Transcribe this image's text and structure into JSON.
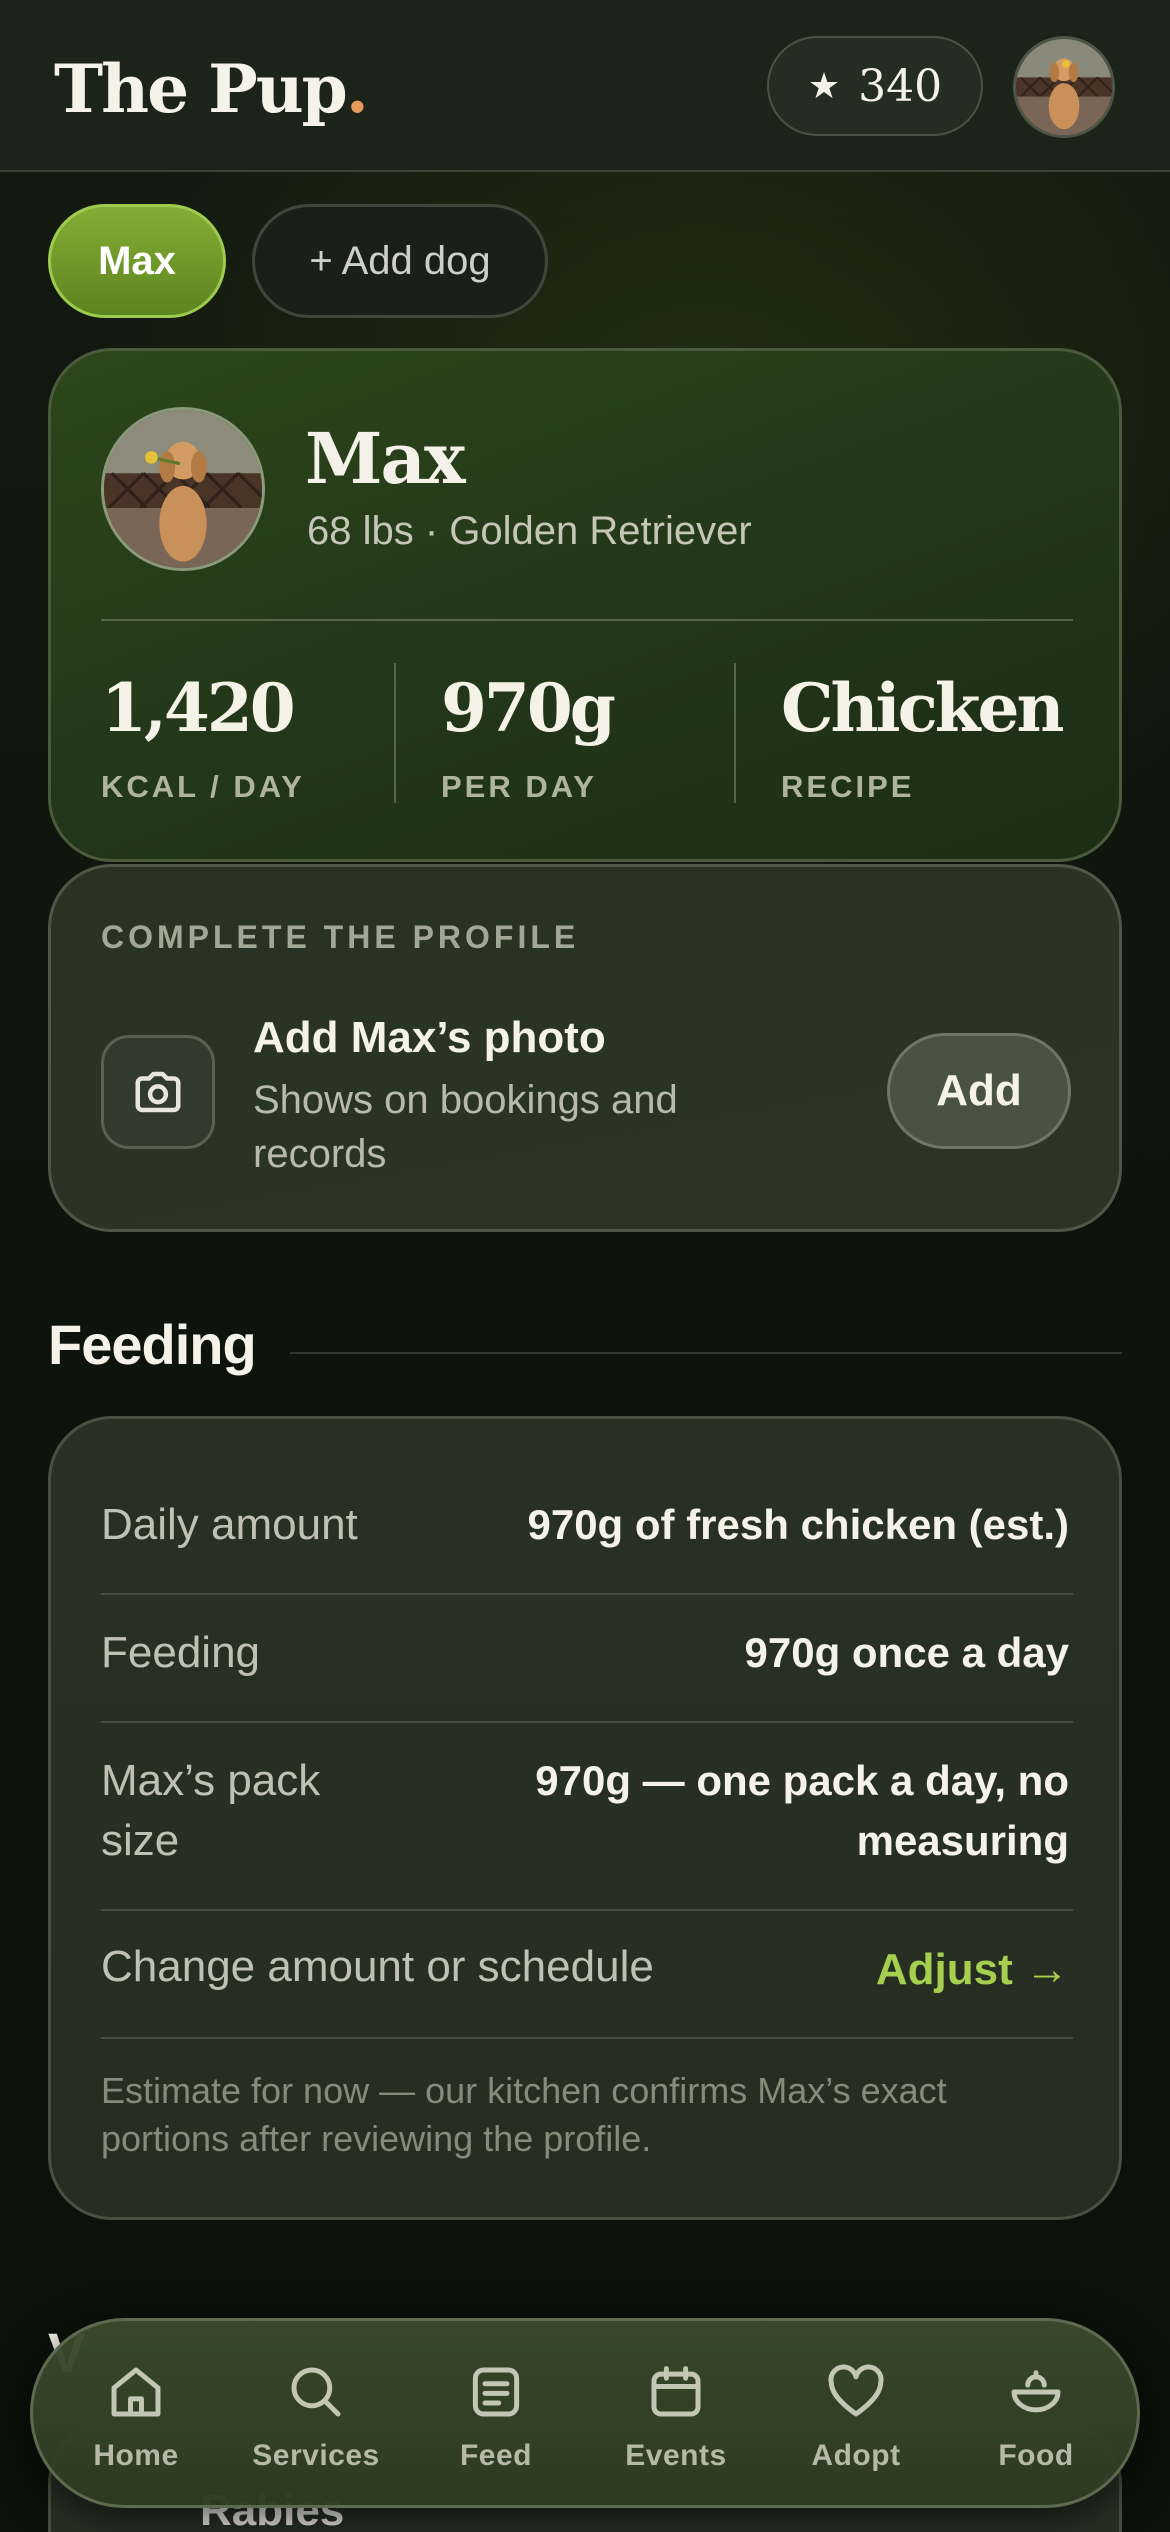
{
  "header": {
    "brand": "The Pup",
    "brand_dot": ".",
    "points": "340"
  },
  "dog_chips": {
    "selected": "Max",
    "add_label": "+ Add dog"
  },
  "profile": {
    "name": "Max",
    "meta": "68 lbs · Golden Retriever",
    "stats": [
      {
        "value": "1,420",
        "label": "KCAL / DAY"
      },
      {
        "value": "970g",
        "label": "PER DAY"
      },
      {
        "value": "Chicken",
        "label": "RECIPE"
      }
    ]
  },
  "complete_profile": {
    "title": "COMPLETE THE PROFILE",
    "heading": "Add Max’s photo",
    "subtext": "Shows on bookings and records",
    "button": "Add"
  },
  "feeding": {
    "title": "Feeding",
    "rows": [
      {
        "label": "Daily amount",
        "value": "970g of fresh chicken (est.)"
      },
      {
        "label": "Feeding",
        "value": "970g once a day"
      },
      {
        "label": "Max’s pack size",
        "value": "970g — one pack a day, no measuring"
      }
    ],
    "change_label": "Change amount or schedule",
    "adjust_label": "Adjust →",
    "note": "Estimate for now — our kitchen confirms Max’s exact portions after reviewing the profile."
  },
  "peek": {
    "heading": "V",
    "item": "Rabies"
  },
  "nav": {
    "items": [
      {
        "label": "Home",
        "icon": "home-icon"
      },
      {
        "label": "Services",
        "icon": "search-icon"
      },
      {
        "label": "Feed",
        "icon": "feed-icon"
      },
      {
        "label": "Events",
        "icon": "calendar-icon"
      },
      {
        "label": "Adopt",
        "icon": "heart-icon"
      },
      {
        "label": "Food",
        "icon": "bowl-icon"
      }
    ]
  },
  "colors": {
    "accent": "#a6cf4f",
    "chip_selected": "#6f9a2a",
    "brand_dot": "#e79a5b",
    "background": "#0f140d"
  }
}
